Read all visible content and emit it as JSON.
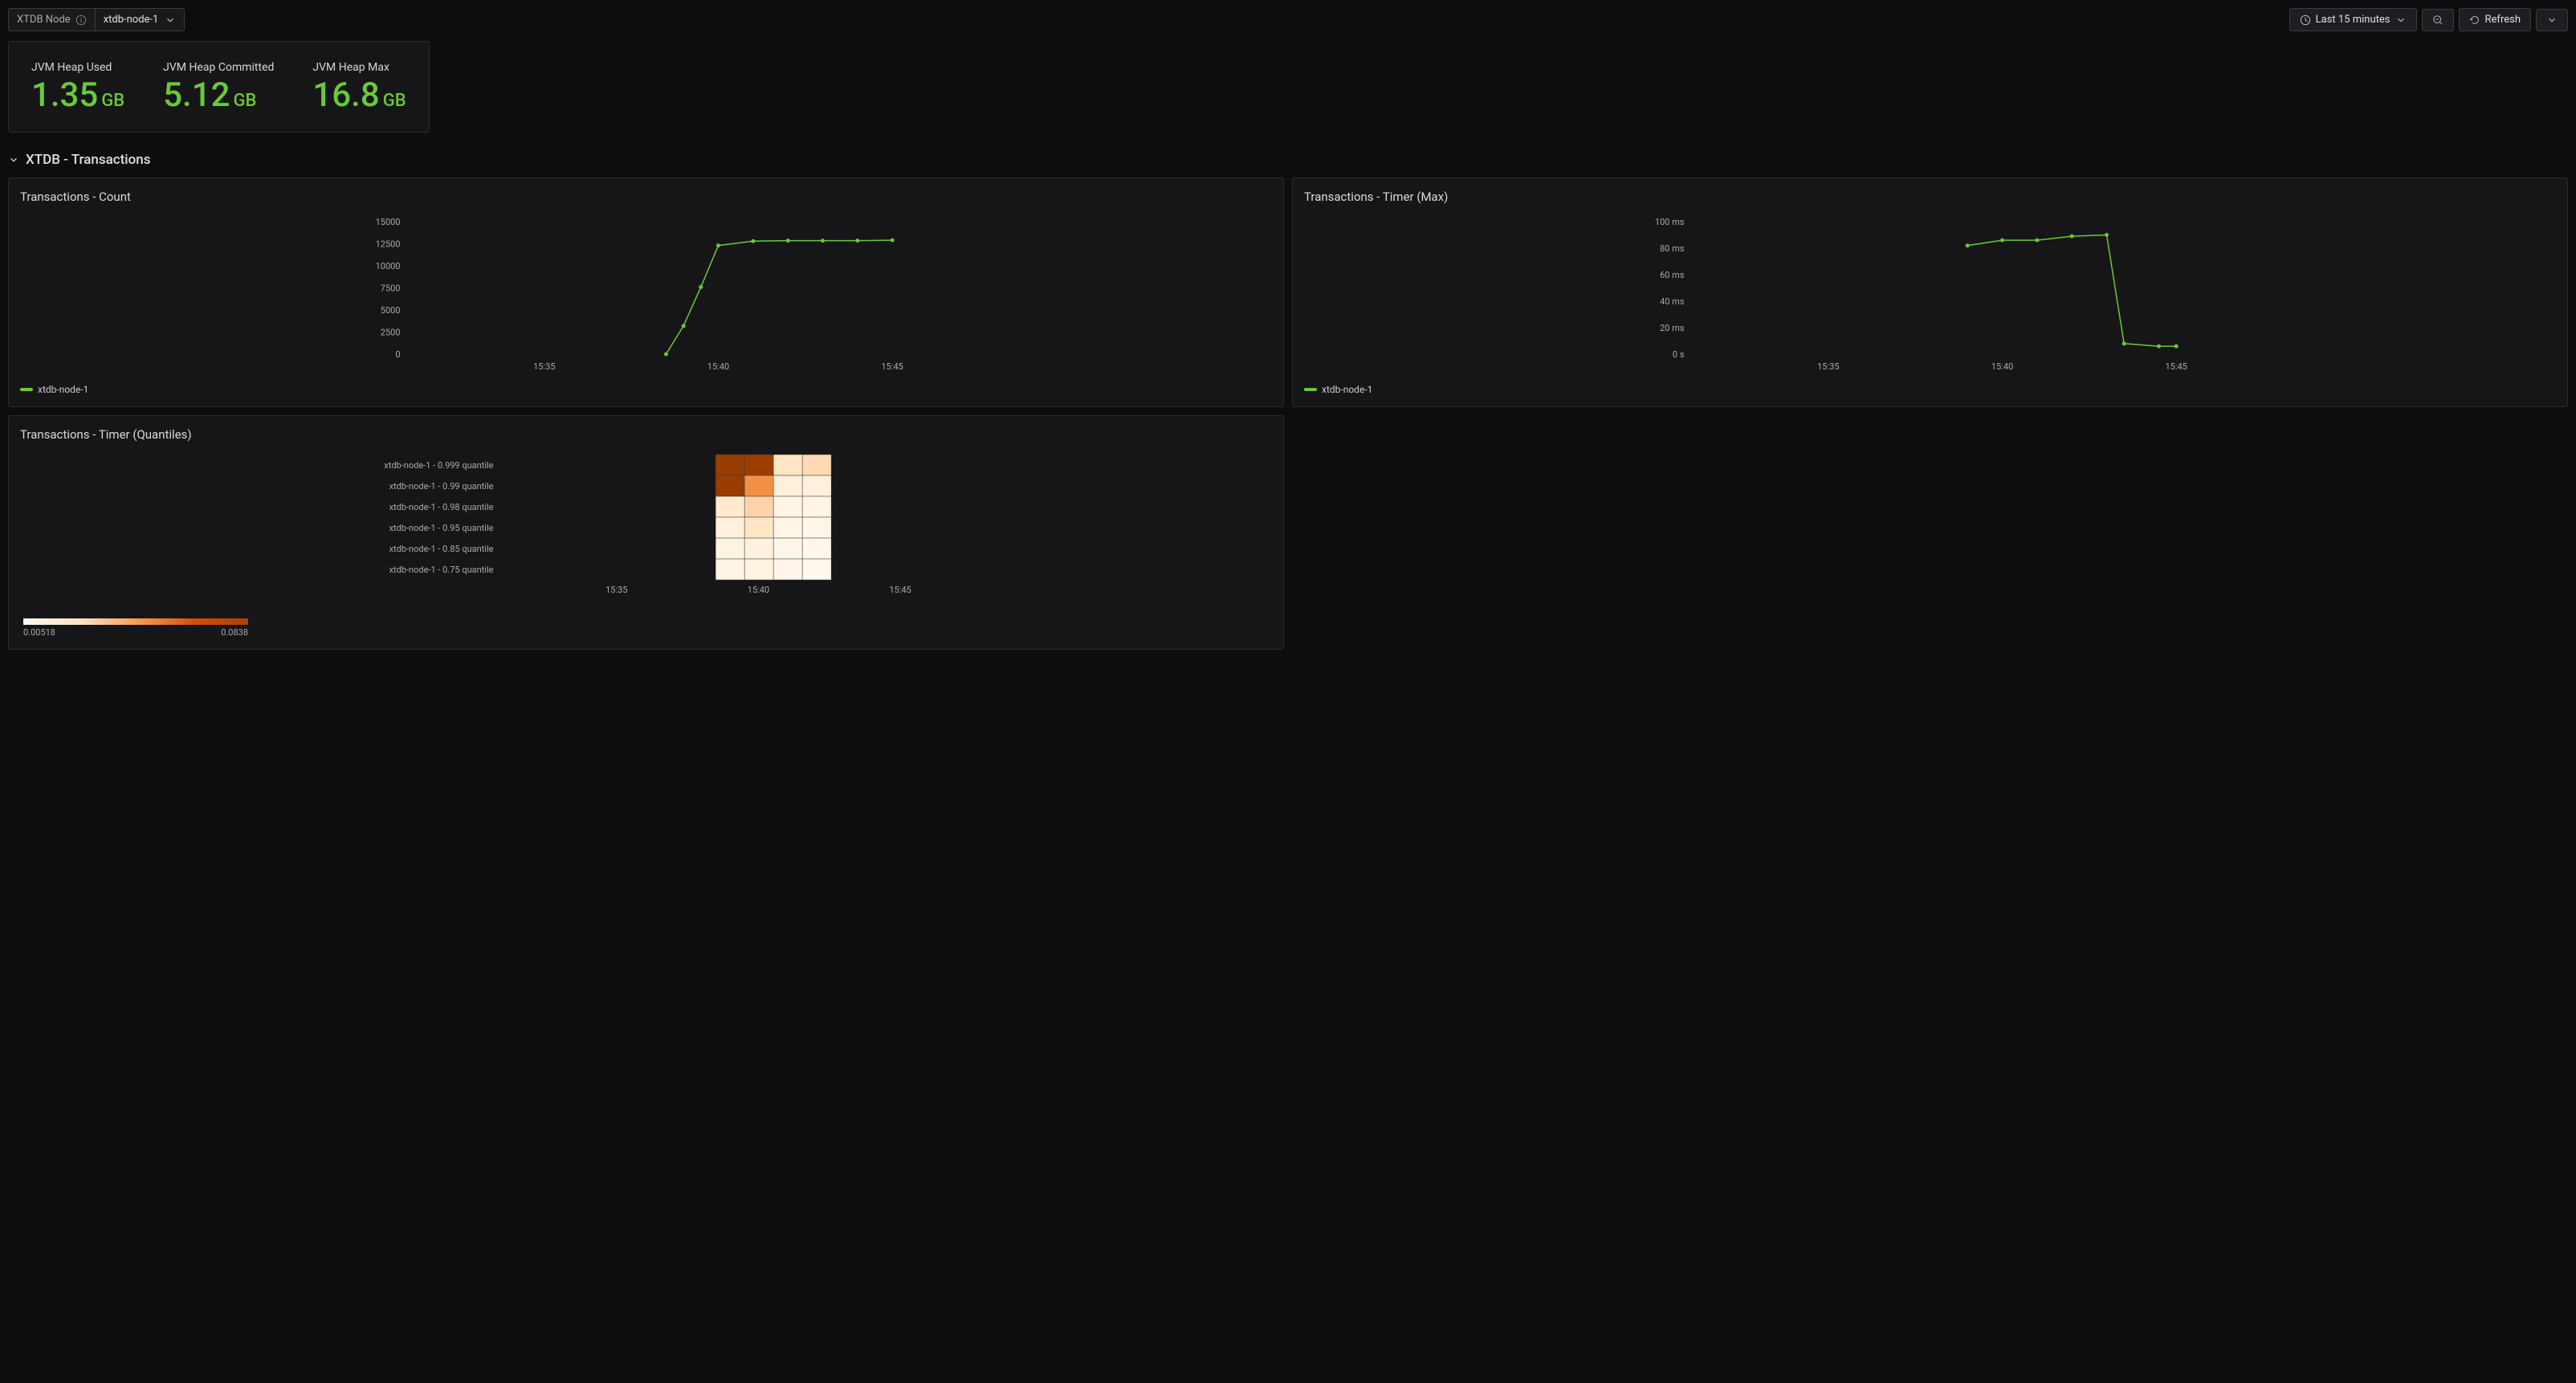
{
  "topbar": {
    "variable_label": "XTDB Node",
    "variable_value": "xtdb-node-1",
    "time_range": "Last 15 minutes",
    "refresh_label": "Refresh"
  },
  "stats": {
    "heap_used": {
      "label": "JVM Heap Used",
      "value": "1.35",
      "unit": "GB"
    },
    "heap_committed": {
      "label": "JVM Heap Committed",
      "value": "5.12",
      "unit": "GB"
    },
    "heap_max": {
      "label": "JVM Heap Max",
      "value": "16.8",
      "unit": "GB"
    }
  },
  "section": {
    "title": "XTDB - Transactions"
  },
  "charts": {
    "count": {
      "title": "Transactions - Count",
      "legend": "xtdb-node-1"
    },
    "timer_max": {
      "title": "Transactions - Timer (Max)",
      "legend": "xtdb-node-1"
    },
    "quantiles": {
      "title": "Transactions - Timer (Quantiles)",
      "scale_min": "0.00518",
      "scale_max": "0.0838"
    }
  },
  "chart_data": [
    {
      "type": "line",
      "title": "Transactions - Count",
      "xlabel": "",
      "ylabel": "",
      "ylim": [
        0,
        15000
      ],
      "y_ticks": [
        0,
        2500,
        5000,
        7500,
        10000,
        12500,
        15000
      ],
      "x_ticks": [
        "15:35",
        "15:40",
        "15:45"
      ],
      "series": [
        {
          "name": "xtdb-node-1",
          "x": [
            "15:38:30",
            "15:39:00",
            "15:39:30",
            "15:40:00",
            "15:41:00",
            "15:42:00",
            "15:43:00",
            "15:44:00",
            "15:45:00"
          ],
          "values": [
            0,
            3200,
            7600,
            12300,
            12800,
            12850,
            12850,
            12850,
            12900
          ]
        }
      ]
    },
    {
      "type": "line",
      "title": "Transactions - Timer (Max)",
      "xlabel": "",
      "ylabel": "",
      "ylim": [
        0,
        100
      ],
      "y_unit": "ms",
      "y_ticks": [
        "0 s",
        "20 ms",
        "40 ms",
        "60 ms",
        "80 ms",
        "100 ms"
      ],
      "x_ticks": [
        "15:35",
        "15:40",
        "15:45"
      ],
      "series": [
        {
          "name": "xtdb-node-1",
          "x": [
            "15:39:00",
            "15:40:00",
            "15:41:00",
            "15:42:00",
            "15:43:00",
            "15:43:30",
            "15:44:30",
            "15:45:00"
          ],
          "values": [
            82,
            86,
            86,
            89,
            90,
            8,
            6,
            6
          ]
        }
      ]
    },
    {
      "type": "heatmap",
      "title": "Transactions - Timer (Quantiles)",
      "x_ticks": [
        "15:35",
        "15:40",
        "15:45"
      ],
      "y_categories": [
        "xtdb-node-1 - 0.999 quantile",
        "xtdb-node-1 - 0.99 quantile",
        "xtdb-node-1 - 0.98 quantile",
        "xtdb-node-1 - 0.95 quantile",
        "xtdb-node-1 - 0.85 quantile",
        "xtdb-node-1 - 0.75 quantile"
      ],
      "x_bins": [
        "15:39:00",
        "15:40:00",
        "15:41:00",
        "15:42:00"
      ],
      "grid": [
        [
          0.0838,
          0.083,
          0.022,
          0.028
        ],
        [
          0.0835,
          0.049,
          0.013,
          0.013
        ],
        [
          0.018,
          0.03,
          0.009,
          0.009
        ],
        [
          0.012,
          0.022,
          0.008,
          0.007
        ],
        [
          0.01,
          0.012,
          0.007,
          0.006
        ],
        [
          0.008,
          0.01,
          0.006,
          0.00518
        ]
      ],
      "color_scale": {
        "min": 0.00518,
        "max": 0.0838
      }
    }
  ]
}
